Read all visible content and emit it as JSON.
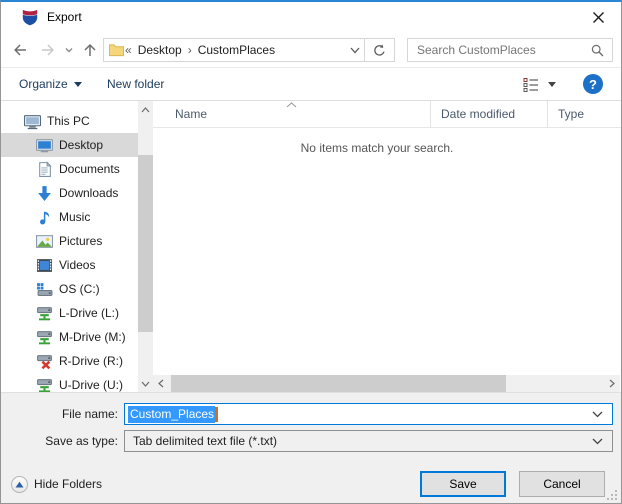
{
  "window": {
    "title": "Export"
  },
  "nav": {
    "breadcrumb_prefix": "«",
    "crumb_desktop": "Desktop",
    "crumb_separator": "›",
    "crumb_customplaces": "CustomPlaces",
    "search_placeholder": "Search CustomPlaces"
  },
  "toolbar": {
    "organize": "Organize",
    "new_folder": "New folder",
    "help": "?"
  },
  "sidebar": {
    "items": [
      {
        "label": "This PC",
        "icon": "computer",
        "level": 1,
        "selected": false
      },
      {
        "label": "Desktop",
        "icon": "desktop",
        "level": 2,
        "selected": true
      },
      {
        "label": "Documents",
        "icon": "documents",
        "level": 2,
        "selected": false
      },
      {
        "label": "Downloads",
        "icon": "downloads",
        "level": 2,
        "selected": false
      },
      {
        "label": "Music",
        "icon": "music",
        "level": 2,
        "selected": false
      },
      {
        "label": "Pictures",
        "icon": "pictures",
        "level": 2,
        "selected": false
      },
      {
        "label": "Videos",
        "icon": "videos",
        "level": 2,
        "selected": false
      },
      {
        "label": "OS (C:)",
        "icon": "os-drive",
        "level": 2,
        "selected": false
      },
      {
        "label": "L-Drive (L:)",
        "icon": "network-drive",
        "level": 2,
        "selected": false
      },
      {
        "label": "M-Drive (M:)",
        "icon": "network-drive",
        "level": 2,
        "selected": false
      },
      {
        "label": "R-Drive (R:)",
        "icon": "network-drive-error",
        "level": 2,
        "selected": false
      },
      {
        "label": "U-Drive (U:)",
        "icon": "network-drive",
        "level": 2,
        "selected": false
      }
    ]
  },
  "filelist": {
    "columns": [
      "Name",
      "Date modified",
      "Type"
    ],
    "empty_message": "No items match your search."
  },
  "form": {
    "file_name_label": "File name:",
    "file_name_value": "Custom_Places",
    "save_as_type_label": "Save as type:",
    "save_as_type_value": "Tab delimited text file (*.txt)"
  },
  "footer": {
    "hide_folders": "Hide Folders",
    "save": "Save",
    "cancel": "Cancel"
  },
  "colors": {
    "accent": "#0078d7",
    "selection": "#3399ff",
    "selected_row": "#d9d9d9",
    "help_blue": "#1d70c8"
  }
}
